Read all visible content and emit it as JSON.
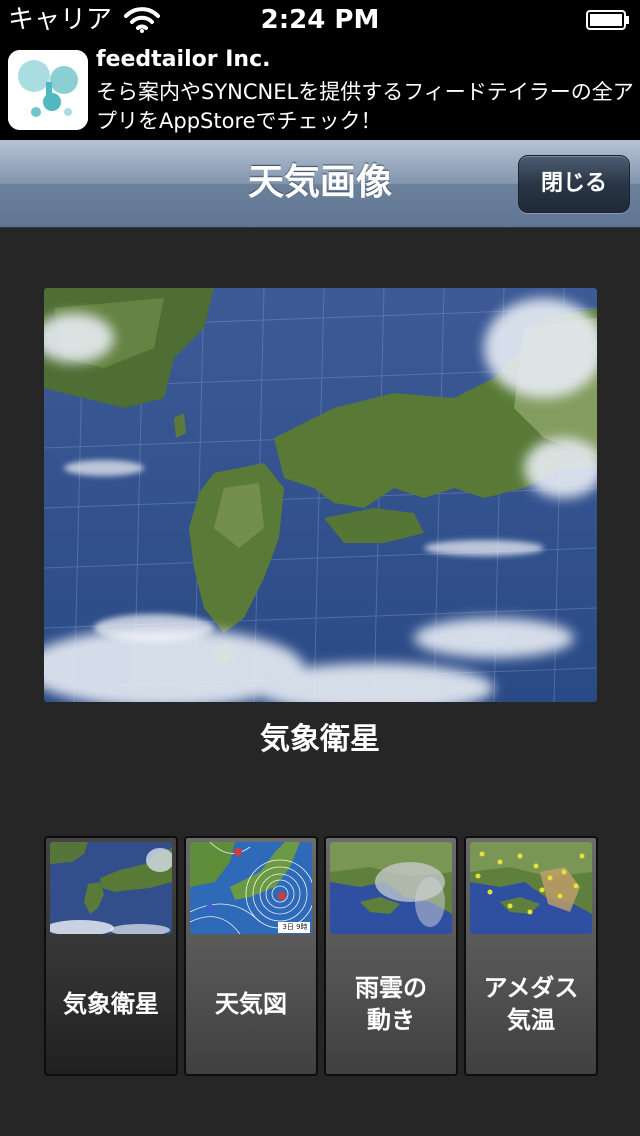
{
  "status_bar": {
    "carrier": "キャリア",
    "time": "2:24 PM",
    "icons": [
      "wifi-icon",
      "battery-icon"
    ]
  },
  "ad": {
    "title": "feedtailor Inc.",
    "text": "そら案内やSYNCNELを提供するフィードテイラーの全アプリをAppStoreでチェック！"
  },
  "nav": {
    "title": "天気画像",
    "close_label": "閉じる"
  },
  "main": {
    "caption": "気象衛星"
  },
  "thumbnails": [
    {
      "label": "気象衛星",
      "selected": true
    },
    {
      "label": "天気図",
      "selected": false
    },
    {
      "label": "雨雲の\n動き",
      "selected": false
    },
    {
      "label": "アメダス\n気温",
      "selected": false
    }
  ],
  "thumbnail_marks": {
    "weather_map_date": "3日 9時"
  },
  "colors": {
    "background": "#262626",
    "nav_bar": "#8396ae",
    "close_button": "#2a3646",
    "ocean": "#2e4f8f"
  }
}
